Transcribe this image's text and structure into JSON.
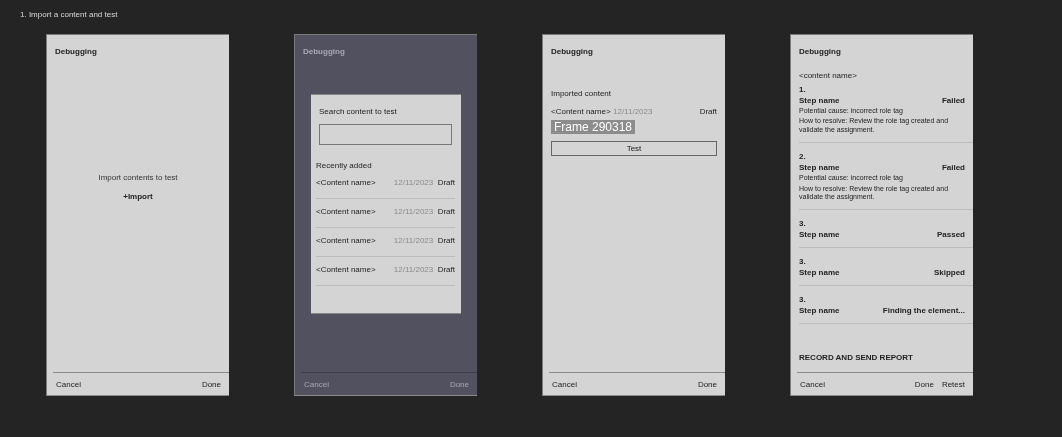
{
  "caption": "1. Import a content and test",
  "frames": [
    {
      "kind": "empty",
      "dimmed": false,
      "title": "Debugging",
      "message": "Import contents to test",
      "action": "+Import",
      "footer": {
        "left": "Cancel",
        "right": [
          "Done"
        ]
      }
    },
    {
      "kind": "search",
      "dimmed": true,
      "title": "Debugging",
      "dialog": {
        "label": "Search content to test",
        "section": "Recently added",
        "items": [
          {
            "name": "<Content name>",
            "date": "12/11/2023",
            "status": "Draft"
          },
          {
            "name": "<Content name>",
            "date": "12/11/2023",
            "status": "Draft"
          },
          {
            "name": "<Content name>",
            "date": "12/11/2023",
            "status": "Draft"
          },
          {
            "name": "<Content name>",
            "date": "12/11/2023",
            "status": "Draft"
          }
        ]
      },
      "footer": {
        "left": "Cancel",
        "right": [
          "Done"
        ]
      }
    },
    {
      "kind": "imported",
      "dimmed": false,
      "title": "Debugging",
      "section": "Imported content",
      "item": {
        "name": "<Content name>",
        "date": "12/11/2023",
        "status": "Draft"
      },
      "overlay_label": "Frame 290318",
      "button": "Test",
      "footer": {
        "left": "Cancel",
        "right": [
          "Done"
        ]
      }
    },
    {
      "kind": "report",
      "dimmed": false,
      "title": "Debugging",
      "content_name": "<content name>",
      "steps": [
        {
          "number": "1.",
          "name": "Step name",
          "result": "Failed",
          "cause": "Potential cause: incorrect role tag",
          "resolution": "How to resolve: Review the role tag created and validate the assignment."
        },
        {
          "number": "2.",
          "name": "Step name",
          "result": "Failed",
          "cause": "Potential cause: incorrect role tag",
          "resolution": "How to resolve: Review the role tag created and validate the assignment."
        },
        {
          "number": "3.",
          "name": "Step name",
          "result": "Passed"
        },
        {
          "number": "3.",
          "name": "Step name",
          "result": "Skipped"
        },
        {
          "number": "3.",
          "name": "Step name",
          "result": "Finding the element..."
        }
      ],
      "report_link": "RECORD AND SEND REPORT",
      "footer": {
        "left": "Cancel",
        "right": [
          "Done",
          "Retest"
        ]
      }
    }
  ]
}
